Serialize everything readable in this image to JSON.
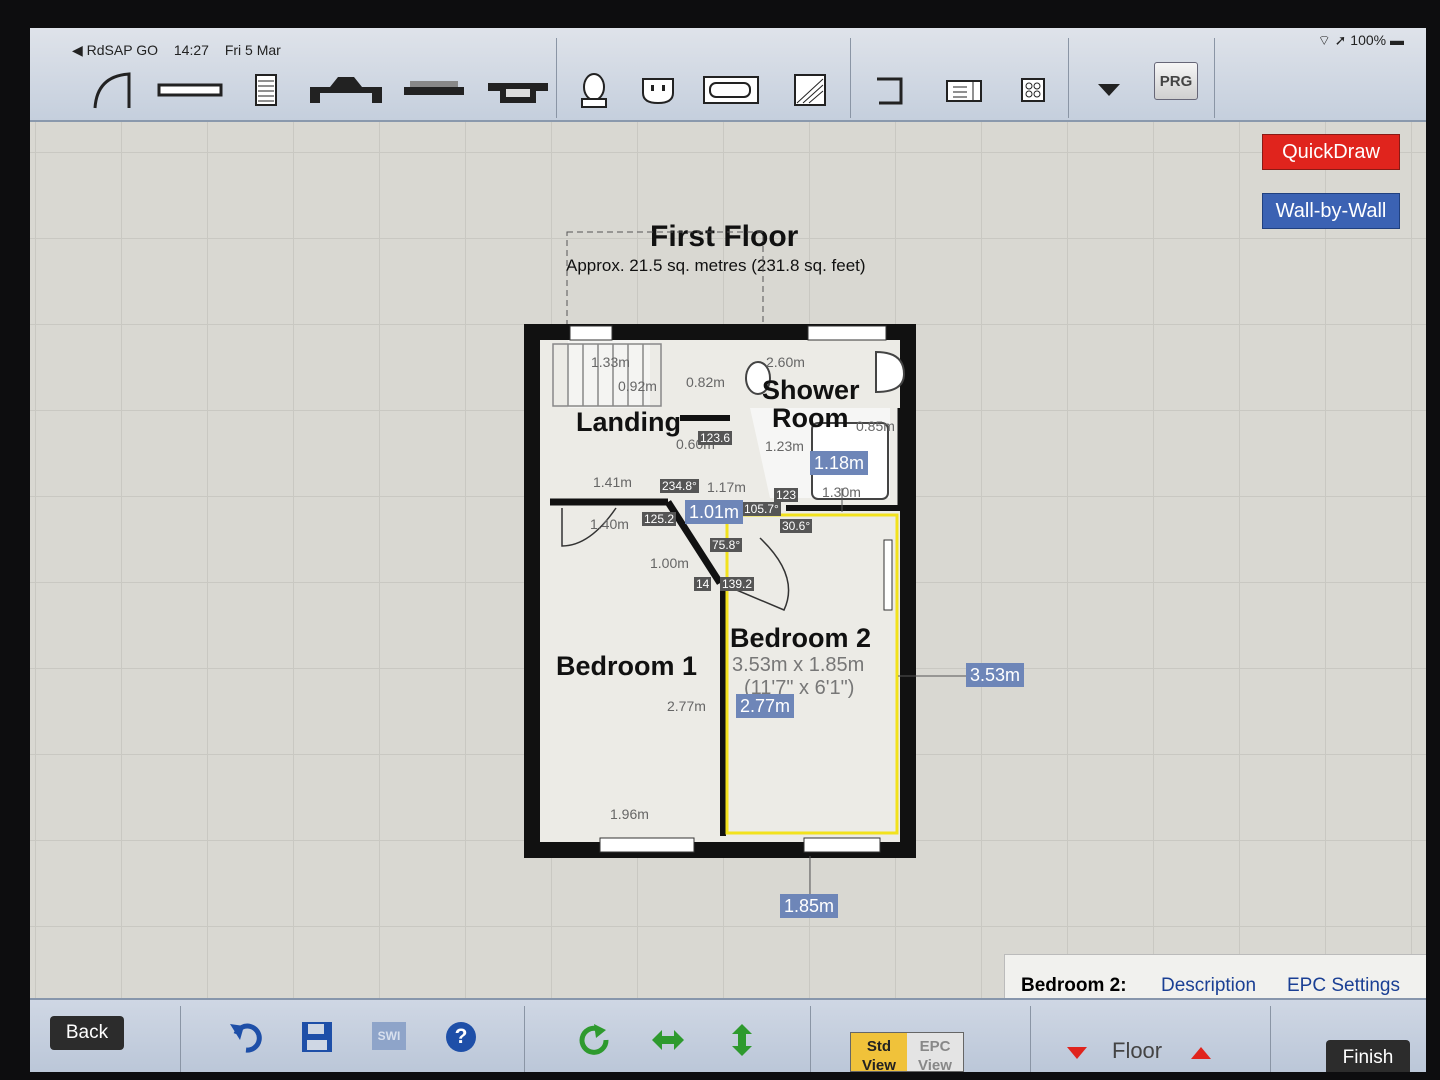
{
  "status_bar": {
    "app_back": "◀ RdSAP GO",
    "time": "14:27",
    "date": "Fri 5 Mar",
    "battery": "100%"
  },
  "toolbar": {
    "tools": [
      "door-tool",
      "wall-tool",
      "radiator-tool",
      "bay-window-tool",
      "heater-tool",
      "recess-tool",
      "toilet-tool",
      "socket-tool",
      "bath-tool",
      "stairs-tool",
      "corner-tool",
      "cupboard-tool",
      "grid-tool",
      "dropdown-tool"
    ],
    "prg_label": "PRG"
  },
  "side_buttons": {
    "quickdraw": "QuickDraw",
    "wall_by_wall": "Wall-by-Wall"
  },
  "plan": {
    "title": "First Floor",
    "subtitle": "Approx. 21.5 sq. metres (231.8 sq. feet)",
    "rooms": {
      "landing": "Landing",
      "shower_room_1": "Shower",
      "shower_room_2": "Room",
      "bedroom1": "Bedroom 1",
      "bedroom2": "Bedroom 2",
      "bedroom2_size": "3.53m x 1.85m",
      "bedroom2_size_imperial": "(11'7\" x 6'1\")"
    },
    "dims": [
      "1.33m",
      "0.92m",
      "0.82m",
      "2.60m",
      "1.23m",
      "0.60m",
      "1.41m",
      "1.17m",
      "1.40m",
      "0.85m",
      "1.00m",
      "2.77m",
      "1.96m",
      "1.30m"
    ],
    "angles": [
      "123.6",
      "234.8°",
      "125.2",
      "105.7°",
      "30.6°",
      "75.8°",
      "14",
      "139.2",
      "123"
    ],
    "measurements": {
      "shower_width": "1.18m",
      "door": "1.01m",
      "bedroom2_height": "3.53m",
      "bedroom2_width_left": "2.77m",
      "bedroom2_width": "1.85m"
    }
  },
  "info_panel": {
    "room": "Bedroom 2:",
    "description": "Description",
    "epc_settings": "EPC Settings"
  },
  "bottom_bar": {
    "back": "Back",
    "sw_label": "SWI",
    "help": "?",
    "std_view_1": "Std",
    "std_view_2": "View",
    "epc_view_1": "EPC",
    "epc_view_2": "View",
    "floor": "Floor",
    "finish": "Finish"
  },
  "colors": {
    "accent_red": "#e0241d",
    "accent_blue": "#3b62b3",
    "selection_yellow": "#f2e21d"
  }
}
